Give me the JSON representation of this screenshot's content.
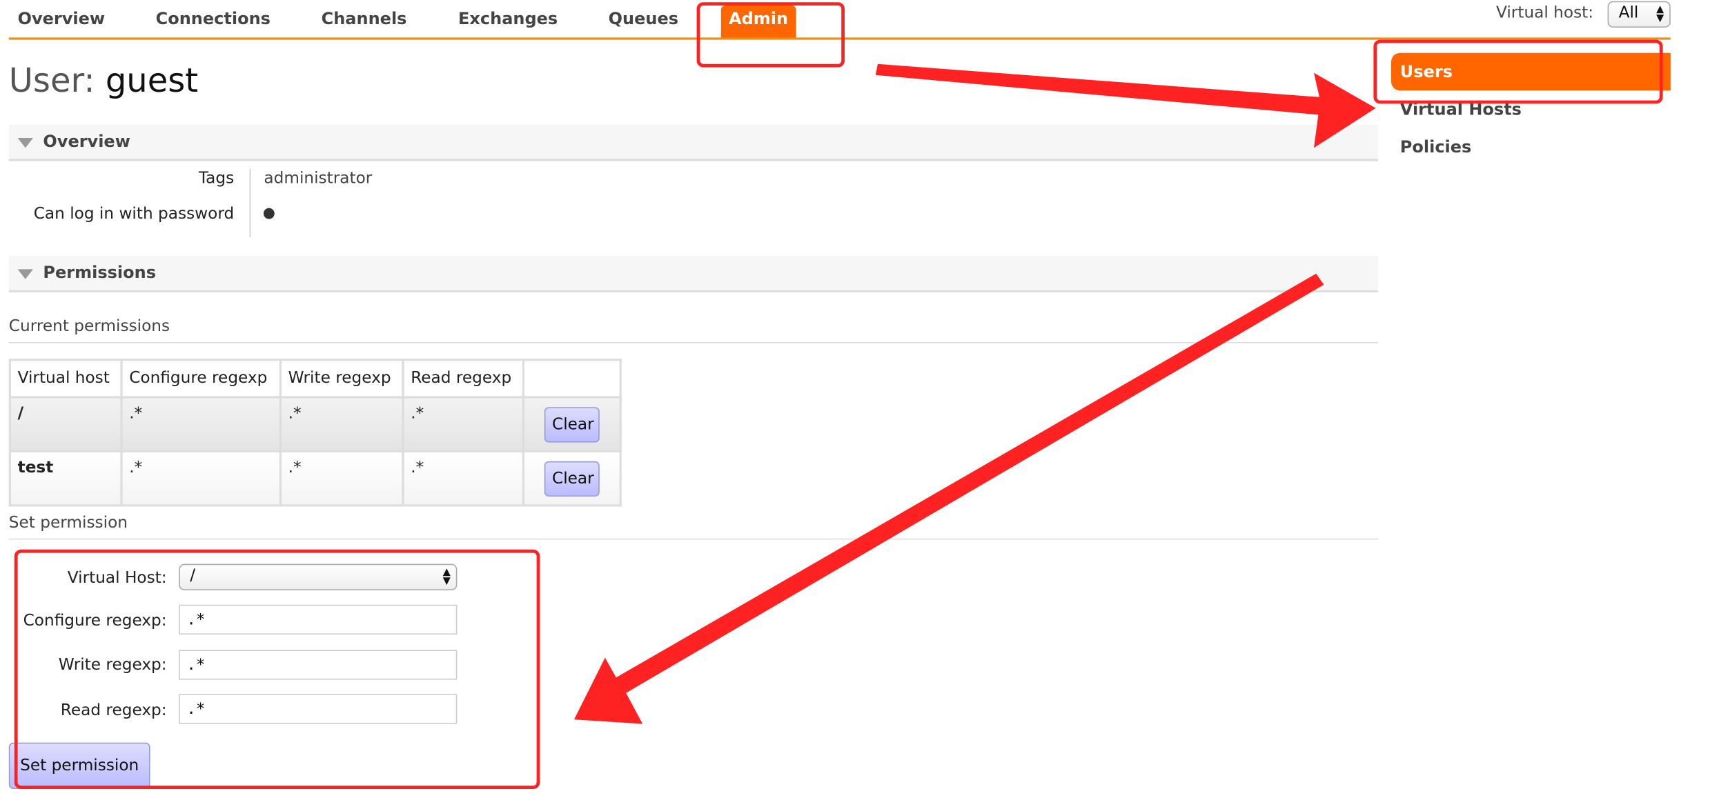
{
  "nav": {
    "tabs": [
      {
        "label": "Overview"
      },
      {
        "label": "Connections"
      },
      {
        "label": "Channels"
      },
      {
        "label": "Exchanges"
      },
      {
        "label": "Queues"
      },
      {
        "label": "Admin",
        "active": true
      }
    ],
    "vhost_label": "Virtual host:",
    "vhost_value": "All"
  },
  "page": {
    "title_prefix": "User:",
    "title_name": "guest"
  },
  "overview": {
    "heading": "Overview",
    "rows": [
      {
        "label": "Tags",
        "value": "administrator"
      },
      {
        "label": "Can log in with password",
        "value": "●"
      }
    ]
  },
  "permissions": {
    "heading": "Permissions",
    "current_label": "Current permissions",
    "columns": [
      "Virtual host",
      "Configure regexp",
      "Write regexp",
      "Read regexp"
    ],
    "rows": [
      {
        "vhost": "/",
        "configure": ".*",
        "write": ".*",
        "read": ".*",
        "action": "Clear"
      },
      {
        "vhost": "test",
        "configure": ".*",
        "write": ".*",
        "read": ".*",
        "action": "Clear"
      }
    ],
    "set_label": "Set permission",
    "form": {
      "vhost_label": "Virtual Host:",
      "vhost_value": "/",
      "configure_label": "Configure regexp:",
      "configure_value": ".*",
      "write_label": "Write regexp:",
      "write_value": ".*",
      "read_label": "Read regexp:",
      "read_value": ".*",
      "submit": "Set permission"
    }
  },
  "sidebar": {
    "items": [
      {
        "label": "Users",
        "active": true
      },
      {
        "label": "Virtual Hosts"
      },
      {
        "label": "Policies"
      }
    ]
  },
  "colors": {
    "accent": "#ff6600",
    "annotation": "#ff2222",
    "button": "#bbbbff"
  }
}
